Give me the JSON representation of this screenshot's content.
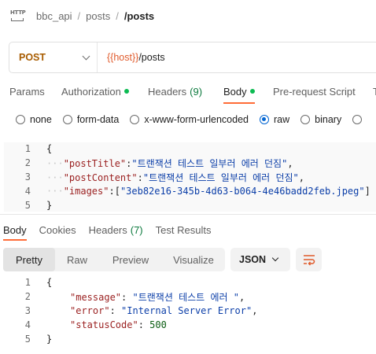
{
  "breadcrumb": {
    "items": [
      "bbc_api",
      "posts"
    ],
    "current": "/posts"
  },
  "request": {
    "method": "POST",
    "url_var": "{{host}}",
    "url_path": "/posts"
  },
  "request_tabs": [
    {
      "label": "Params"
    },
    {
      "label": "Authorization"
    },
    {
      "label": "Headers",
      "count": "(9)"
    },
    {
      "label": "Body"
    },
    {
      "label": "Pre-request Script"
    },
    {
      "label": "T"
    }
  ],
  "body_types": [
    "none",
    "form-data",
    "x-www-form-urlencoded",
    "raw",
    "binary"
  ],
  "body_type_selected": "raw",
  "request_body": {
    "line_numbers": [
      "1",
      "2",
      "3",
      "4",
      "5"
    ],
    "brace_open": "{",
    "brace_close": "}",
    "fields": [
      {
        "key": "\"postTitle\"",
        "value": "\"트랜잭션 테스트 일부러 에러 던짐\"",
        "trail": ","
      },
      {
        "key": "\"postContent\"",
        "value": "\"트랜잭션 테스트 일부러 에러 던짐\"",
        "trail": ","
      },
      {
        "key": "\"images\"",
        "value": "\"3eb82e16-345b-4d63-b064-4e46badd2feb.jpeg\"",
        "trail": ""
      }
    ]
  },
  "response_tabs": [
    {
      "label": "Body"
    },
    {
      "label": "Cookies"
    },
    {
      "label": "Headers",
      "count": "(7)"
    },
    {
      "label": "Test Results"
    }
  ],
  "response_views": [
    "Pretty",
    "Raw",
    "Preview",
    "Visualize"
  ],
  "response_format": "JSON",
  "response_body": {
    "line_numbers": [
      "1",
      "2",
      "3",
      "4",
      "5"
    ],
    "brace_open": "{",
    "brace_close": "}",
    "fields": [
      {
        "key": "\"message\"",
        "value": "\"트랜잭션 테스트 에러 \"",
        "trail": ","
      },
      {
        "key": "\"error\"",
        "value": "\"Internal Server Error\"",
        "trail": ","
      },
      {
        "key": "\"statusCode\"",
        "value": "500",
        "trail": ""
      }
    ]
  },
  "icons": {
    "http": "http-icon",
    "method_dropdown": "chevron-down-icon",
    "format_dropdown": "chevron-down-icon",
    "wrap": "text-wrap-icon"
  },
  "colors": {
    "accent": "#ff6c37",
    "method_post": "#a85c00",
    "url_variable": "#e05a2b",
    "status_dot": "#0cbb52",
    "radio_selected": "#0265d2"
  }
}
